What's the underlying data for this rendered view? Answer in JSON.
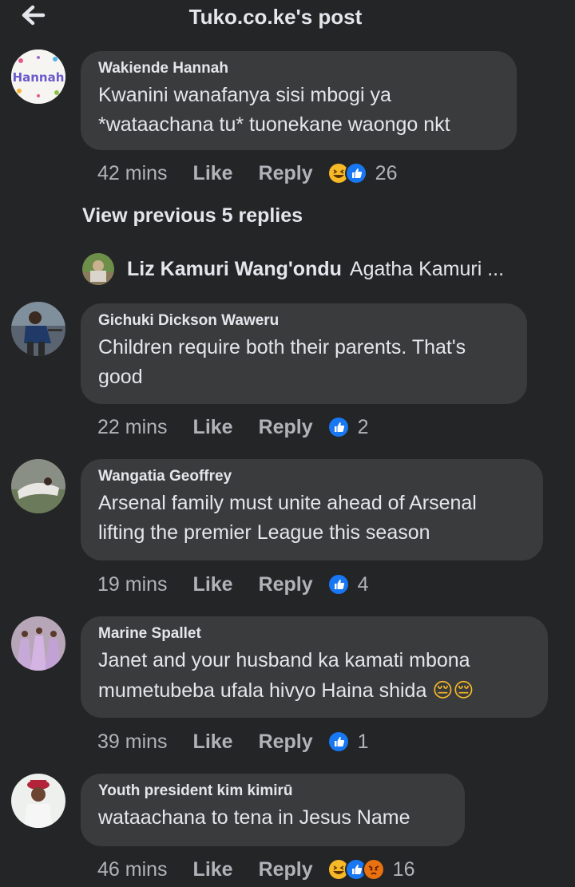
{
  "header": {
    "title": "Tuko.co.ke's post"
  },
  "labels": {
    "like": "Like",
    "reply": "Reply"
  },
  "comments": [
    {
      "author": "Wakiende Hannah",
      "text": "Kwanini wanafanya sisi mbogi ya *wataachana  tu* tuonekane waongo nkt",
      "time": "42 mins",
      "reactions": [
        "haha",
        "like"
      ],
      "reaction_count": "26",
      "avatar_text": "Hannah"
    },
    {
      "author": "Gichuki Dickson Waweru",
      "text": "Children require both their parents. That's good",
      "time": "22 mins",
      "reactions": [
        "like"
      ],
      "reaction_count": "2"
    },
    {
      "author": "Wangatia Geoffrey",
      "text": "Arsenal family must unite ahead of Arsenal lifting the premier League this season",
      "time": "19 mins",
      "reactions": [
        "like"
      ],
      "reaction_count": "4"
    },
    {
      "author": "Marine Spallet",
      "text": "Janet and your husband ka kamati mbona mumetubeba ufala hivyo Haina shida",
      "emoji": "😔😔",
      "time": "39 mins",
      "reactions": [
        "like"
      ],
      "reaction_count": "1"
    },
    {
      "author": "Youth president kim kimirū",
      "text": "wataachana to tena in Jesus Name",
      "time": "46 mins",
      "reactions": [
        "haha",
        "like",
        "angry"
      ],
      "reaction_count": "16"
    }
  ],
  "view_previous": "View previous 5 replies",
  "reply_preview": {
    "name": "Liz Kamuri Wang'ondu",
    "text": "Agatha Kamuri ..."
  },
  "colors": {
    "background": "#242526",
    "bubble": "#3a3b3c",
    "like_blue": "#1877f2",
    "muted": "#b0b3b8"
  },
  "icons": {
    "back": "arrow-left-icon",
    "like": "like-reaction-icon",
    "haha": "haha-reaction-icon",
    "angry": "angry-reaction-icon"
  }
}
